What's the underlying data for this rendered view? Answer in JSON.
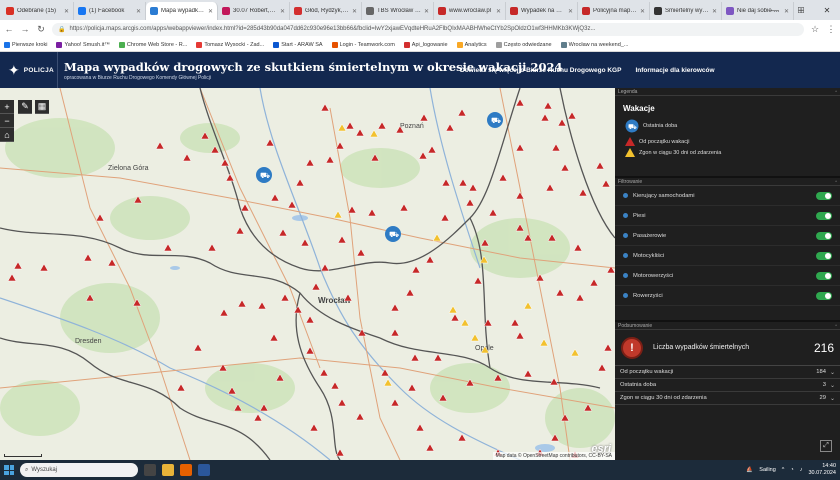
{
  "browser": {
    "tabs": [
      {
        "label": "Odebrane (15)",
        "color": "#d93025",
        "active": false
      },
      {
        "label": "(1) Facebook",
        "color": "#1877f2",
        "active": false
      },
      {
        "label": "Mapa wypadków",
        "color": "#2b7cd3",
        "active": true
      },
      {
        "label": "30.07 Robert, M...",
        "color": "#c2185b",
        "active": false
      },
      {
        "label": "Głód, Rydzyk, Cz...",
        "color": "#d32f2f",
        "active": false
      },
      {
        "label": "TBS Wrocław mieszk...",
        "color": "#666666",
        "active": false
      },
      {
        "label": "www.wroclaw.pl",
        "color": "#c62828",
        "active": false
      },
      {
        "label": "Wypadek na W...",
        "color": "#c62828",
        "active": false
      },
      {
        "label": "Policyjna mapa...",
        "color": "#c62828",
        "active": false
      },
      {
        "label": "Śmiertelny wyp...",
        "color": "#333333",
        "active": false
      },
      {
        "label": "Nie daj sobie wł...",
        "color": "#7e57c2",
        "active": false
      }
    ],
    "new_tab": "+",
    "url": "https://policja.maps.arcgis.com/apps/webappviewer/index.html?id=285d43b90da047dd62c930e96e13bb66&fbclid=IwY2xjawEVqdteHRuA2FlbQIxMAABHWheCtYb2SpOldzO1wf3HHMKb3KWjQ3z...",
    "bookmarks": [
      "Pierwsze kroki",
      "Yahoo! Smush.it™",
      "Chrome Web Store - R...",
      "Tomasz Wysocki - Zad...",
      "Start - ARAW SA",
      "Login - Teamwork.com",
      "Api_logowanie",
      "Analytics",
      "Często odwiedzane",
      "Wrocław na weekend_..."
    ]
  },
  "header": {
    "logo_text": "POLICJA",
    "title": "Mapa wypadków drogowych ze skutkiem śmiertelnym w okresie wakacji 2024",
    "subtitle": "opracowana w Biurze Ruchu Drogowego Komendy Głównej Policji",
    "link_more": "Dowiedz się więcej o Biurze Ruchu Drogowego KGP",
    "link_drivers": "Informacje dla kierowców"
  },
  "map": {
    "attribution": "Map data © OpenStreetMap contributors, CC-BY-SA",
    "esri": "esri",
    "cities": [
      "Wrocław",
      "Dresden",
      "Zielona Góra",
      "Poznań",
      "Opole"
    ]
  },
  "legend": {
    "section": "Legenda",
    "title": "Wakacje",
    "items": [
      "Ostatnia doba",
      "Od początku wakacji",
      "Zgon w ciągu 30 dni od zdarzenia"
    ]
  },
  "filters": {
    "section": "Filtrowanie",
    "items": [
      "Kierujący samochodami",
      "Piesi",
      "Pasażerowie",
      "Motocykliści",
      "Motorowerzyści",
      "Rowerzyści"
    ]
  },
  "summary": {
    "section": "Podsumowanie",
    "title": "Liczba wypadków śmiertelnych",
    "total": "216",
    "rows": [
      {
        "label": "Od początku wakacji",
        "value": "184"
      },
      {
        "label": "Ostatnia doba",
        "value": "3"
      },
      {
        "label": "Zgon w ciągu 30 dni od zdarzenia",
        "value": "29"
      }
    ]
  },
  "taskbar": {
    "search": "Wyszukaj",
    "weather": "Sailing",
    "time": "14:40",
    "date": "30.07.2024"
  }
}
